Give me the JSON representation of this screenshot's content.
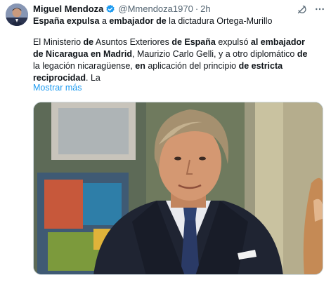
{
  "author": {
    "display_name": "Miguel Mendoza",
    "handle": "@Mmendoza1970",
    "separator": "·",
    "time": "2h"
  },
  "headline": {
    "part1": "España expulsa",
    "part2": " a ",
    "part3": "embajador de",
    "part4": " la dictadura Ortega-Murillo"
  },
  "body": {
    "s1": "El Ministerio ",
    "s2": "de",
    "s3": " Asuntos Exteriores ",
    "s4": "de España",
    "s5": " expulsó ",
    "s6": "al embajador de Nicaragua en Madrid",
    "s7": ", Maurizio Carlo Gelli, y a otro diplomático ",
    "s8": "de",
    "s9": " la legación nicaragüense, ",
    "s10": "en",
    "s11": " aplicación del principio ",
    "s12": "de estricta reciprocidad",
    "s13": ". La"
  },
  "show_more": "Mostrar más",
  "icons": {
    "verified": "verified-badge-icon",
    "grok": "grok-icon",
    "more": "more-icon"
  },
  "colors": {
    "link": "#1d9bf0",
    "verified": "#1d9bf0",
    "muted": "#536471"
  }
}
